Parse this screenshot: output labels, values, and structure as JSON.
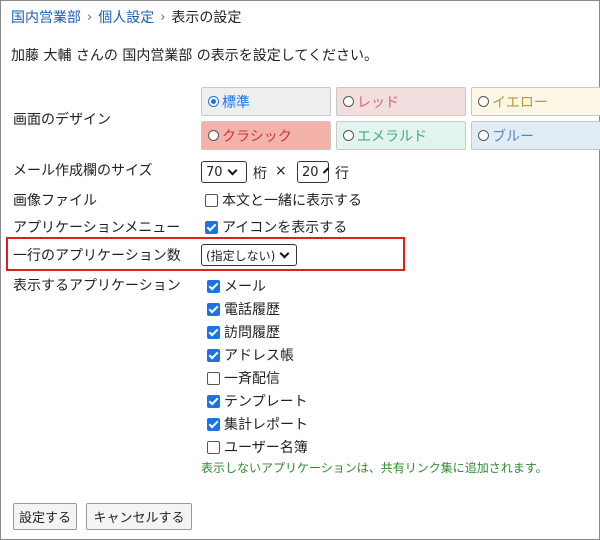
{
  "breadcrumb": {
    "items": [
      "国内営業部",
      "個人設定"
    ],
    "separator": "›",
    "current": "表示の設定"
  },
  "intro": {
    "user": "加藤 大輔",
    "mid1": " さんの ",
    "org": "国内営業部",
    "mid2": " の表示を設定してください。"
  },
  "design": {
    "label": "画面のデザイン",
    "options": [
      {
        "label": "標準",
        "bg": "#eeeeee",
        "text": "#1a73e8",
        "selected": true
      },
      {
        "label": "レッド",
        "bg": "#f2dede",
        "text": "#d26b6b",
        "selected": false
      },
      {
        "label": "イエロー",
        "bg": "#fbf7e4",
        "text": "#b59a3a",
        "selected": false
      },
      {
        "label": "クラシック",
        "bg": "#f3b3ab",
        "text": "#c43b30",
        "selected": false
      },
      {
        "label": "エメラルド",
        "bg": "#e2f4ee",
        "text": "#4aa58a",
        "selected": false
      },
      {
        "label": "ブルー",
        "bg": "#e2ecf7",
        "text": "#5a86c0",
        "selected": false
      }
    ]
  },
  "mail_size": {
    "label": "メール作成欄のサイズ",
    "cols_value": "70",
    "cols_unit": "桁",
    "times": "×",
    "rows_value": "20",
    "rows_unit": "行"
  },
  "image_file": {
    "label": "画像ファイル",
    "checkbox_label": "本文と一緒に表示する",
    "checked": false
  },
  "app_menu": {
    "label": "アプリケーションメニュー",
    "checkbox_label": "アイコンを表示する",
    "checked": true
  },
  "apps_per_row": {
    "label": "一行のアプリケーション数",
    "value": "(指定しない)"
  },
  "apps": {
    "label": "表示するアプリケーション",
    "items": [
      {
        "label": "メール",
        "checked": true
      },
      {
        "label": "電話履歴",
        "checked": true
      },
      {
        "label": "訪問履歴",
        "checked": true
      },
      {
        "label": "アドレス帳",
        "checked": true
      },
      {
        "label": "一斉配信",
        "checked": false
      },
      {
        "label": "テンプレート",
        "checked": true
      },
      {
        "label": "集計レポート",
        "checked": true
      },
      {
        "label": "ユーザー名簿",
        "checked": false
      }
    ],
    "note": "表示しないアプリケーションは、共有リンク集に追加されます。"
  },
  "buttons": {
    "submit": "設定する",
    "cancel": "キャンセルする"
  },
  "colors": {
    "link": "#1a5fb4",
    "note": "#2e8b2e",
    "highlight": "#e0201e",
    "accent": "#1a73e8"
  }
}
